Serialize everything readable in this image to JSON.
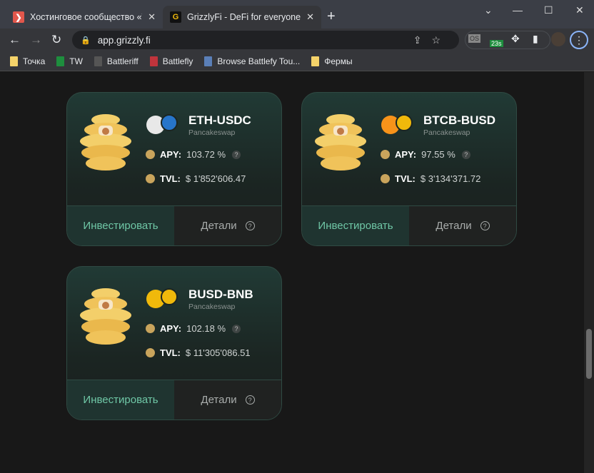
{
  "browser": {
    "tabs": [
      {
        "title": "Хостинговое сообщество «Timeweb»",
        "favicon": "chevron"
      },
      {
        "title": "GrizzlyFi - DeFi for everyone.",
        "favicon": "G"
      }
    ],
    "url": "app.grizzly.fi",
    "ext_badge": "23s",
    "ext_os": "OS",
    "bookmarks": [
      {
        "label": "Точка"
      },
      {
        "label": "TW"
      },
      {
        "label": "Battleriff"
      },
      {
        "label": "Battlefly"
      },
      {
        "label": "Browse Battlefy Tou..."
      },
      {
        "label": "Фермы"
      }
    ]
  },
  "labels": {
    "apy": "APY:",
    "tvl": "TVL:",
    "invest": "Инвестировать",
    "details": "Детали"
  },
  "pools": [
    {
      "name": "ETH-USDC",
      "dex": "Pancakeswap",
      "apy": "103.72 %",
      "tvl": "$ 1'852'606.47",
      "coins": [
        "#e8e8e8",
        "#2775ca"
      ]
    },
    {
      "name": "BTCB-BUSD",
      "dex": "Pancakeswap",
      "apy": "97.55 %",
      "tvl": "$ 3'134'371.72",
      "coins": [
        "#f7931a",
        "#f0b90b"
      ]
    },
    {
      "name": "BUSD-BNB",
      "dex": "Pancakeswap",
      "apy": "102.18 %",
      "tvl": "$ 11'305'086.51",
      "coins": [
        "#f0b90b",
        "#f0b90b"
      ]
    }
  ]
}
